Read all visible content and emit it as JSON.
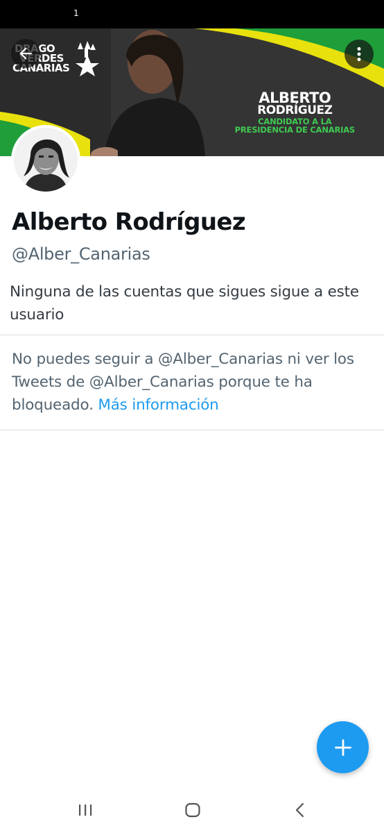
{
  "status_bar": {
    "indicator": "1"
  },
  "banner": {
    "logo_lines": [
      "DRAGO",
      "VERDES",
      "CANARIAS"
    ],
    "name_line1": "ALBERTO",
    "name_line2": "RODRÍGUEZ",
    "tagline_line1": "CANDIDATO A LA",
    "tagline_line2": "PRESIDENCIA DE CANARIAS",
    "colors": {
      "green": "#1f9e3a",
      "yellow": "#e8e10d",
      "dark": "#2b2b2b"
    }
  },
  "toolbar": {
    "back_icon": "arrow-left-icon",
    "more_icon": "more-vertical-icon"
  },
  "profile": {
    "display_name": "Alberto Rodríguez",
    "handle": "@Alber_Canarias",
    "followers_you_know": "Ninguna de las cuentas que sigues sigue a este usuario"
  },
  "blocked": {
    "message": "No puedes seguir a @Alber_Canarias ni ver los Tweets de @Alber_Canarias porque te ha bloqueado.",
    "link_label": "Más información"
  },
  "fab": {
    "icon": "plus-icon",
    "color": "#1d9bf0"
  },
  "nav_bar": {
    "icons": [
      "recent-apps-icon",
      "home-icon",
      "back-icon"
    ]
  }
}
